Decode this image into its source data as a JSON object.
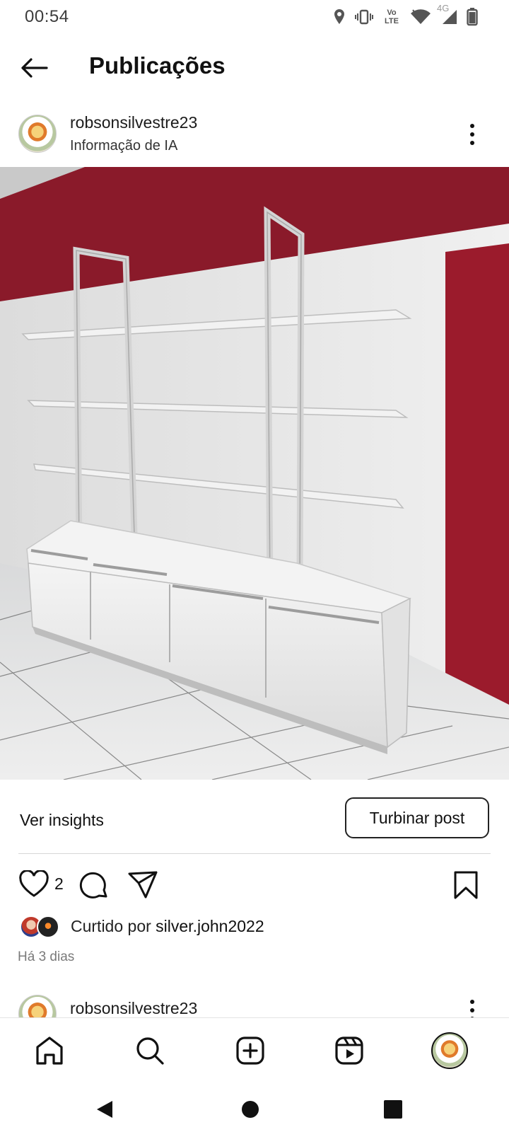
{
  "status_bar": {
    "time": "00:54",
    "volte_line1": "Vo",
    "volte_line2": "LTE",
    "network": "4G"
  },
  "header": {
    "title": "Publicações",
    "back_icon": "arrow-left-icon"
  },
  "post": {
    "username": "robsonsilvestre23",
    "subtitle": "Informação de IA",
    "more_icon": "more-vertical-icon",
    "image_alt": "White shelving unit with cabinets against red wall"
  },
  "insights": {
    "label": "Ver insights",
    "boost_label": "Turbinar post"
  },
  "actions": {
    "like_count": "2",
    "icons": [
      "heart-icon",
      "comment-icon",
      "share-icon",
      "bookmark-icon"
    ]
  },
  "likes": {
    "prefix": "Curtido por ",
    "user": "silver.john2022"
  },
  "time_ago": "Há 3 dias",
  "next_post": {
    "username": "robsonsilvestre23"
  },
  "bottom_nav": {
    "items": [
      "home-icon",
      "search-icon",
      "create-icon",
      "reels-icon",
      "profile-avatar"
    ]
  },
  "colors": {
    "wall_red": "#8e1a2a",
    "text_primary": "#111111",
    "text_secondary": "#7a7a7a"
  }
}
